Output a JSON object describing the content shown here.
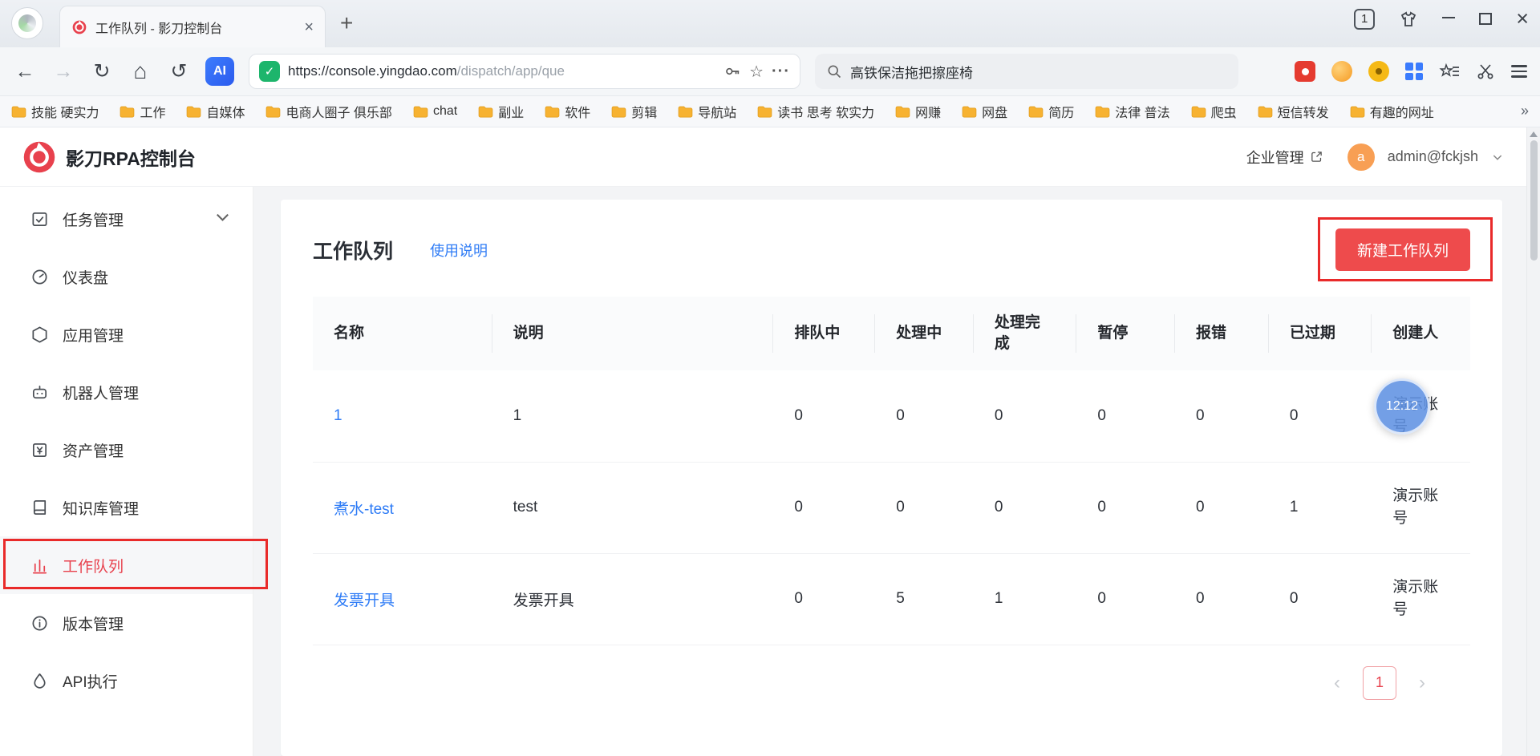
{
  "browser": {
    "tab_title": "工作队列 - 影刀控制台",
    "tab_count_badge": "1",
    "url_host": "https://console.yingdao.com",
    "url_path": "/dispatch/app/que",
    "search_query": "高铁保洁拖把擦座椅",
    "bookmarks": [
      "技能 硬实力",
      "工作",
      "自媒体",
      "电商人圈子 俱乐部",
      "chat",
      "副业",
      "软件",
      "剪辑",
      "导航站",
      "读书 思考 软实力",
      "网赚",
      "网盘",
      "简历",
      "法律 普法",
      "爬虫",
      "短信转发",
      "有趣的网址"
    ],
    "bookmarks_overflow": "»"
  },
  "header": {
    "brand": "影刀RPA控制台",
    "enterprise_link": "企业管理",
    "avatar_letter": "a",
    "account": "admin@fckjsh"
  },
  "sidebar": {
    "items": [
      {
        "label": "任务管理",
        "icon": "task",
        "expandable": true,
        "active": false
      },
      {
        "label": "仪表盘",
        "icon": "dashboard",
        "expandable": false,
        "active": false
      },
      {
        "label": "应用管理",
        "icon": "app",
        "expandable": false,
        "active": false
      },
      {
        "label": "机器人管理",
        "icon": "robot",
        "expandable": false,
        "active": false
      },
      {
        "label": "资产管理",
        "icon": "asset",
        "expandable": false,
        "active": false
      },
      {
        "label": "知识库管理",
        "icon": "knowledge",
        "expandable": false,
        "active": false
      },
      {
        "label": "工作队列",
        "icon": "queue",
        "expandable": false,
        "active": true
      },
      {
        "label": "版本管理",
        "icon": "version",
        "expandable": false,
        "active": false
      },
      {
        "label": "API执行",
        "icon": "api",
        "expandable": false,
        "active": false
      }
    ]
  },
  "main": {
    "title": "工作队列",
    "help_link": "使用说明",
    "new_button": "新建工作队列",
    "table": {
      "headers": [
        "名称",
        "说明",
        "排队中",
        "处理中",
        "处理完成",
        "暂停",
        "报错",
        "已过期",
        "创建人"
      ],
      "rows": [
        {
          "name": "1",
          "desc": "1",
          "queued": "0",
          "processing": "0",
          "done": "0",
          "paused": "0",
          "error": "0",
          "expired": "0",
          "creator": "演示账号"
        },
        {
          "name": "煮水-test",
          "desc": "test",
          "queued": "0",
          "processing": "0",
          "done": "0",
          "paused": "0",
          "error": "0",
          "expired": "1",
          "creator": "演示账号"
        },
        {
          "name": "发票开具",
          "desc": "发票开具",
          "queued": "0",
          "processing": "5",
          "done": "1",
          "paused": "0",
          "error": "0",
          "expired": "0",
          "creator": "演示账号"
        }
      ]
    },
    "pagination": {
      "current": "1"
    },
    "clock_overlay": "12:12"
  },
  "colors": {
    "accent_red": "#ee4b4c",
    "link_blue": "#2f7cf6",
    "shield_green": "#1db56c"
  }
}
